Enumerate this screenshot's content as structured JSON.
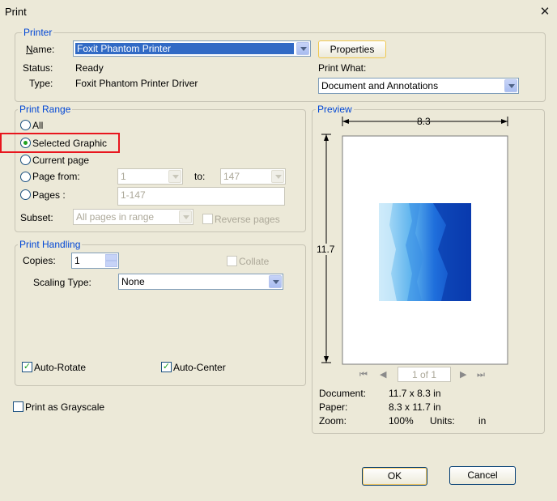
{
  "window": {
    "title": "Print",
    "close_glyph": "✕"
  },
  "printer": {
    "legend": "Printer",
    "name_label": "Name:",
    "name_value": "Foxit Phantom Printer",
    "properties_button": "Properties",
    "status_label": "Status:",
    "status_value": "Ready",
    "type_label": "Type:",
    "type_value": "Foxit Phantom Printer Driver",
    "print_what_label": "Print What:",
    "print_what_value": "Document and Annotations"
  },
  "print_range": {
    "legend": "Print Range",
    "all_label": "All",
    "selected_graphic_label": "Selected Graphic",
    "current_page_label": "Current page",
    "page_from_label": "Page from:",
    "page_from_value": "1",
    "to_label": "to:",
    "to_value": "147",
    "pages_label": "Pages :",
    "pages_value": "1-147",
    "subset_label": "Subset:",
    "subset_value": "All pages in range",
    "reverse_pages_label": "Reverse pages",
    "selected_option": "selected_graphic",
    "highlight_color": "#e8161e"
  },
  "print_handling": {
    "legend": "Print Handling",
    "copies_label": "Copies:",
    "copies_value": "1",
    "collate_label": "Collate",
    "scaling_label": "Scaling Type:",
    "scaling_value": "None",
    "auto_rotate_label": "Auto-Rotate",
    "auto_center_label": "Auto-Center",
    "auto_rotate_checked": true,
    "auto_center_checked": true
  },
  "grayscale_label": "Print as Grayscale",
  "preview": {
    "legend": "Preview",
    "width_label": "8.3",
    "height_label": "11.7",
    "page_indicator": "1 of 1",
    "document_label": "Document:",
    "document_value": "11.7 x 8.3 in",
    "paper_label": "Paper:",
    "paper_value": "8.3 x 11.7 in",
    "zoom_label": "Zoom:",
    "zoom_value": "100%",
    "units_label": "Units:",
    "units_value": "in"
  },
  "buttons": {
    "ok": "OK",
    "cancel": "Cancel"
  }
}
